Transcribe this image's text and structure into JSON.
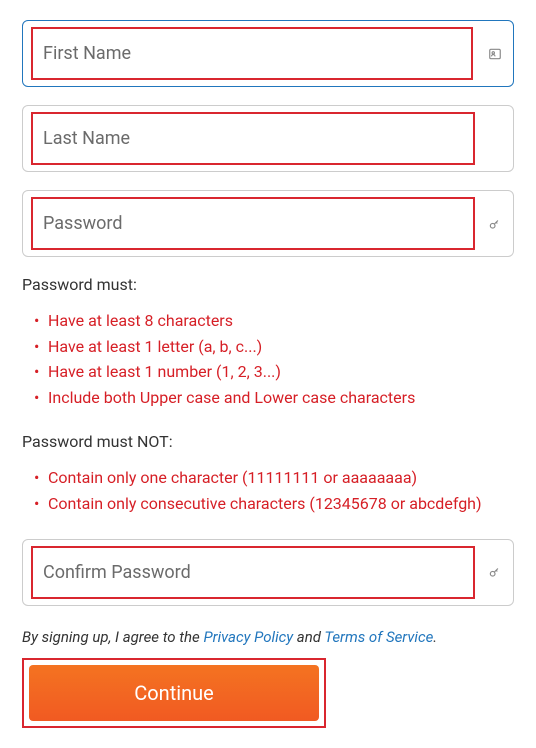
{
  "fields": {
    "firstName": {
      "placeholder": "First Name"
    },
    "lastName": {
      "placeholder": "Last Name"
    },
    "password": {
      "placeholder": "Password"
    },
    "confirmPassword": {
      "placeholder": "Confirm Password"
    }
  },
  "rules": {
    "mustHeading": "Password must:",
    "mustItems": [
      "Have at least 8 characters",
      "Have at least 1 letter (a, b, c...)",
      "Have at least 1 number (1, 2, 3...)",
      "Include both Upper case and Lower case characters"
    ],
    "mustNotHeading": "Password must NOT:",
    "mustNotItems": [
      "Contain only one character (11111111 or aaaaaaaa)",
      "Contain only consecutive characters (12345678 or abcdefgh)"
    ]
  },
  "agreement": {
    "prefix": "By signing up, I agree to the ",
    "privacyLink": "Privacy Policy",
    "and": " and ",
    "termsLink": "Terms of Service",
    "suffix": "."
  },
  "continueButton": "Continue"
}
